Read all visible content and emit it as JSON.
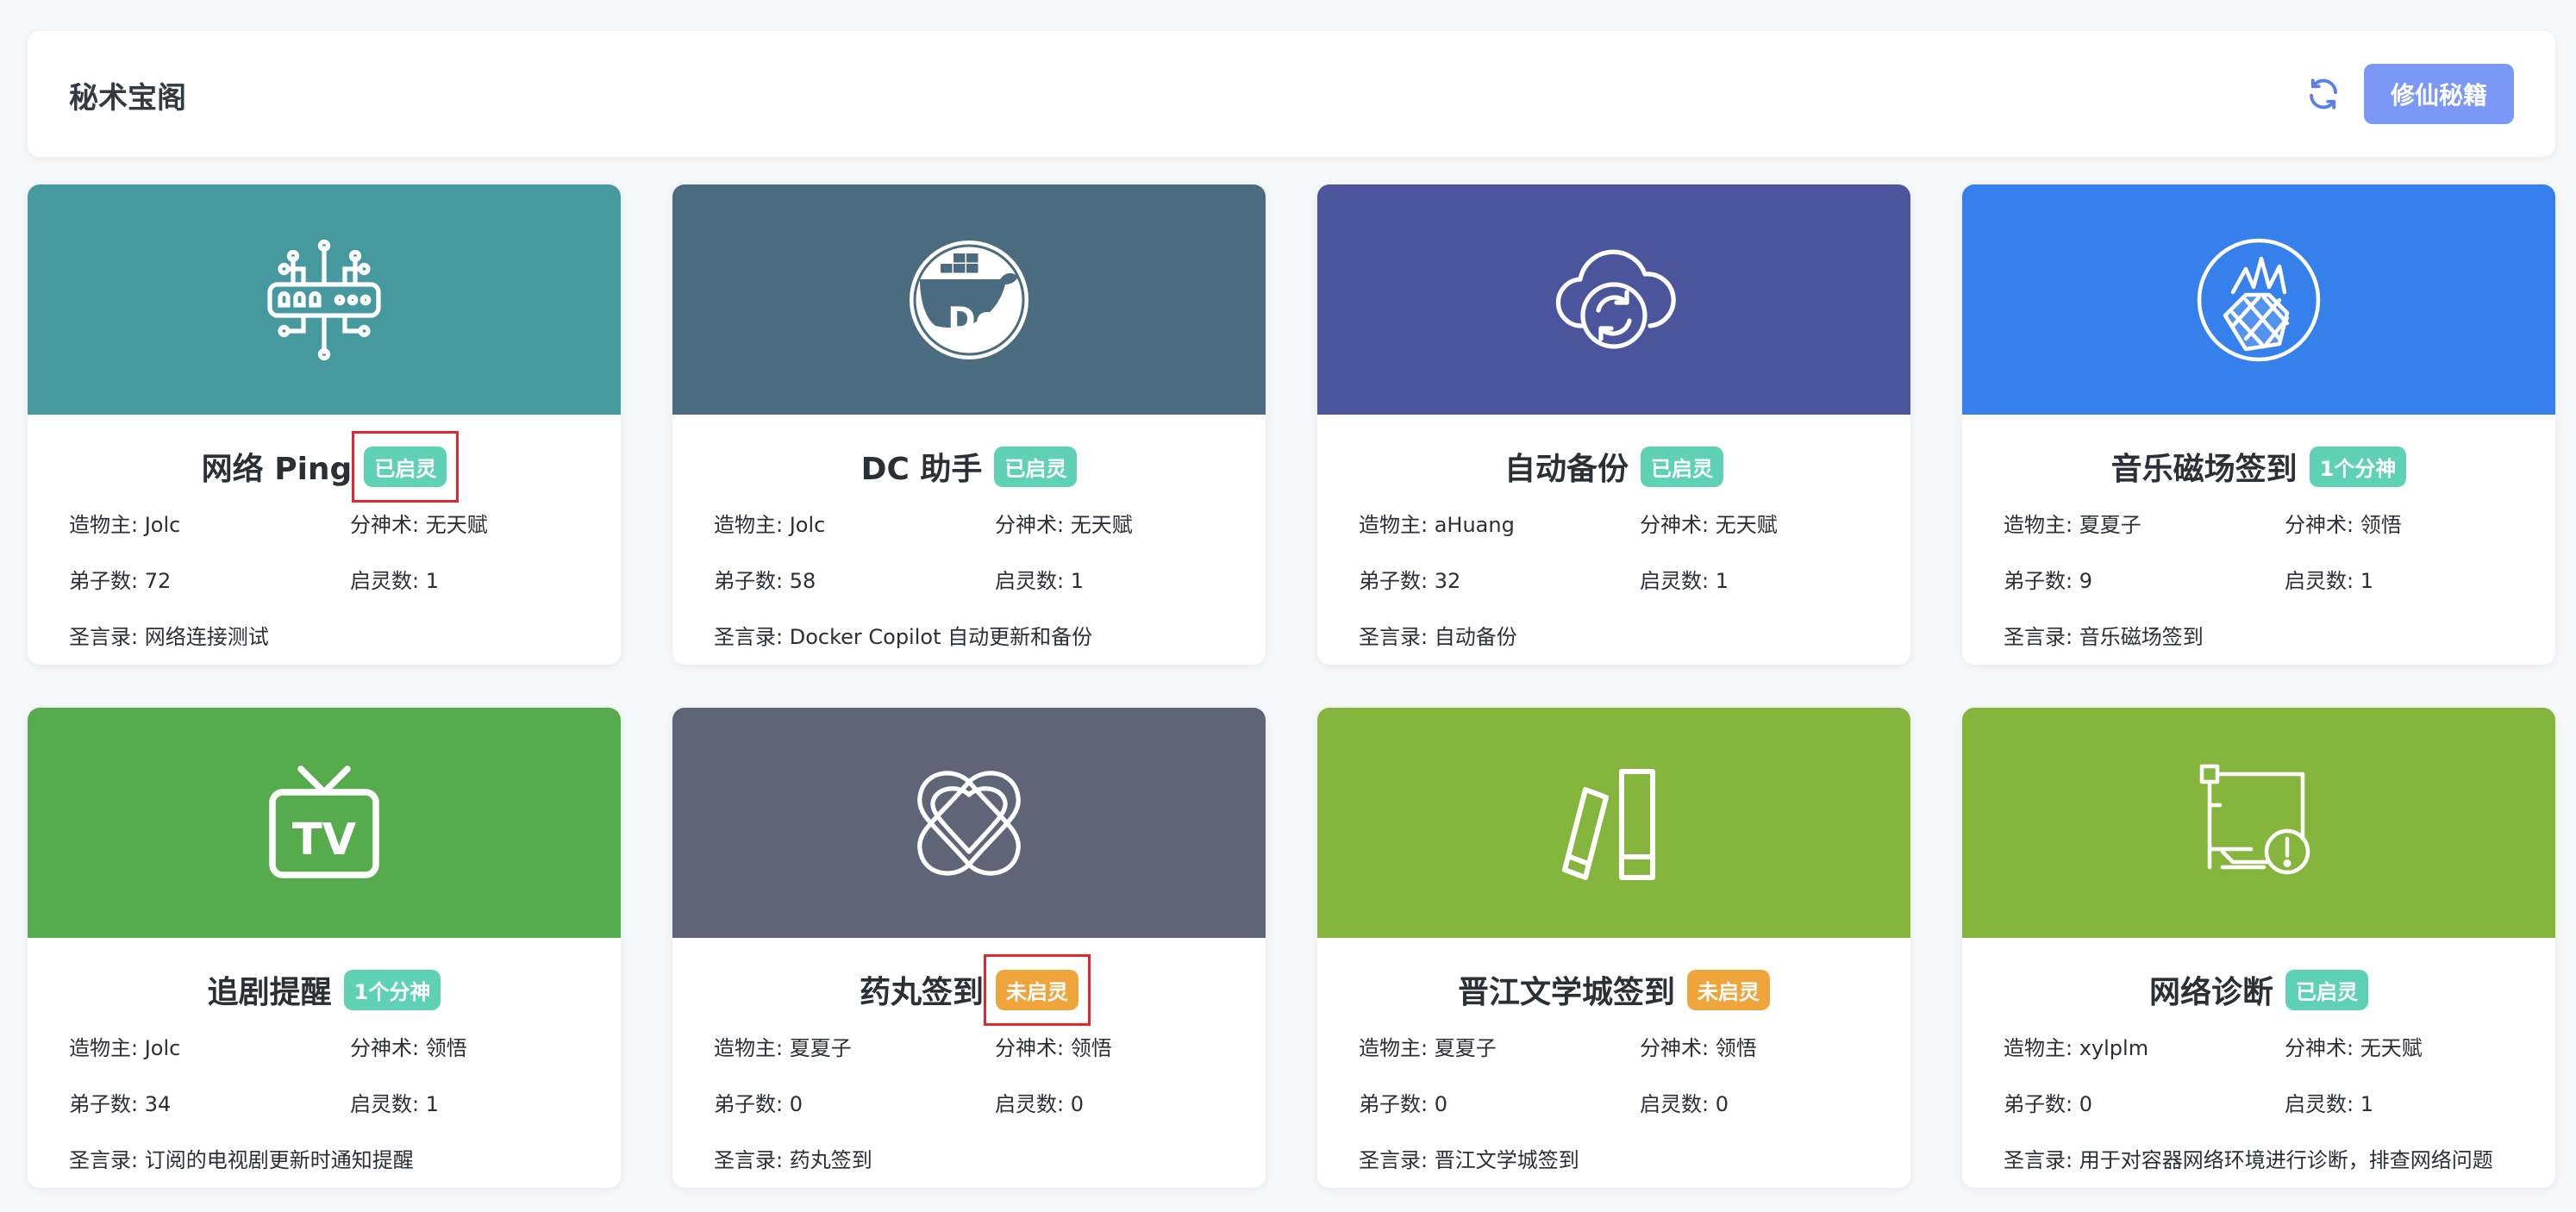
{
  "page": {
    "title": "秘术宝阁",
    "primary_button": "修仙秘籍",
    "refresh_icon": "refresh-icon"
  },
  "labels": {
    "author": "造物主: ",
    "category": "分神术: ",
    "disciples": "弟子数: ",
    "enabled": "启灵数: ",
    "description": "圣言录: "
  },
  "colors": {
    "badge_green": "#5fd1b5",
    "badge_orange": "#efa53c",
    "primary": "#7c98f6",
    "highlight_box": "#e2262d"
  },
  "cards": [
    {
      "title": "网络 Ping",
      "badge": "已启灵",
      "badge_color": "#5fd1b5",
      "highlighted": true,
      "author": "Jolc",
      "category": "无天赋",
      "disciples": "72",
      "enabled": "1",
      "description": "网络连接测试",
      "banner_color": "#45999f",
      "icon": "network-circuit-icon"
    },
    {
      "title": "DC 助手",
      "badge": "已启灵",
      "badge_color": "#5fd1b5",
      "highlighted": false,
      "author": "Jolc",
      "category": "无天赋",
      "disciples": "58",
      "enabled": "1",
      "description": "Docker Copilot 自动更新和备份",
      "banner_color": "#4a6b80",
      "icon": "docker-whale-icon"
    },
    {
      "title": "自动备份",
      "badge": "已启灵",
      "badge_color": "#5fd1b5",
      "highlighted": false,
      "author": "aHuang",
      "category": "无天赋",
      "disciples": "32",
      "enabled": "1",
      "description": "自动备份",
      "banner_color": "#4b559c",
      "icon": "cloud-sync-icon"
    },
    {
      "title": "音乐磁场签到",
      "badge": "1个分神",
      "badge_color": "#5fd1b5",
      "highlighted": false,
      "author": "夏夏子",
      "category": "领悟",
      "disciples": "9",
      "enabled": "1",
      "description": "音乐磁场签到",
      "banner_color": "#3580ea",
      "icon": "pineapple-icon"
    },
    {
      "title": "追剧提醒",
      "badge": "1个分神",
      "badge_color": "#5fd1b5",
      "highlighted": false,
      "author": "Jolc",
      "category": "领悟",
      "disciples": "34",
      "enabled": "1",
      "description": "订阅的电视剧更新时通知提醒",
      "banner_color": "#56ab4c",
      "icon": "tv-icon"
    },
    {
      "title": "药丸签到",
      "badge": "未启灵",
      "badge_color": "#efa53c",
      "highlighted": true,
      "author": "夏夏子",
      "category": "领悟",
      "disciples": "0",
      "enabled": "0",
      "description": "药丸签到",
      "banner_color": "#5f6577",
      "icon": "knot-icon"
    },
    {
      "title": "晋江文学城签到",
      "badge": "未启灵",
      "badge_color": "#efa53c",
      "highlighted": false,
      "author": "夏夏子",
      "category": "领悟",
      "disciples": "0",
      "enabled": "0",
      "description": "晋江文学城签到",
      "banner_color": "#85b53c",
      "icon": "books-icon"
    },
    {
      "title": "网络诊断",
      "badge": "已启灵",
      "badge_color": "#5fd1b5",
      "highlighted": false,
      "author": "xylplm",
      "category": "无天赋",
      "disciples": "0",
      "enabled": "1",
      "description": "用于对容器网络环境进行诊断，排查网络问题",
      "banner_color": "#85b53c",
      "icon": "network-warning-icon"
    }
  ]
}
